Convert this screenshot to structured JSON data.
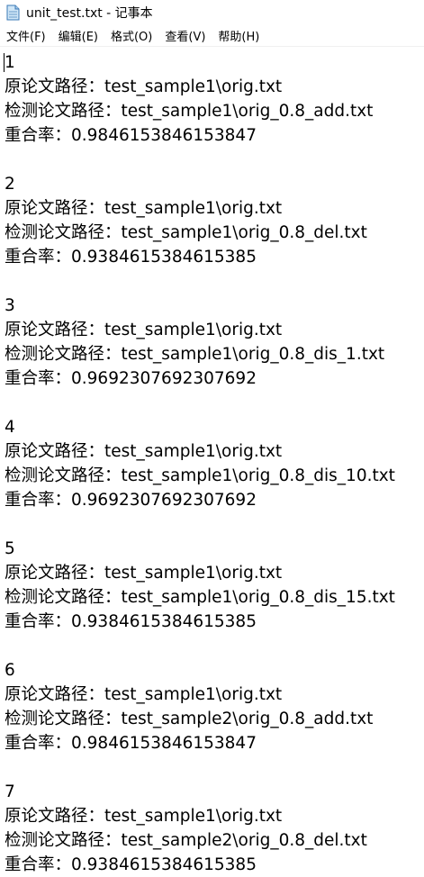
{
  "window": {
    "title": "unit_test.txt - 记事本"
  },
  "menu": [
    {
      "label": "文件(F)"
    },
    {
      "label": "编辑(E)"
    },
    {
      "label": "格式(O)"
    },
    {
      "label": "查看(V)"
    },
    {
      "label": "帮助(H)"
    }
  ],
  "document": {
    "lines": [
      "1",
      "原论文路径：test_sample1\\orig.txt",
      "检测论文路径：test_sample1\\orig_0.8_add.txt",
      "重合率：0.9846153846153847",
      "",
      "2",
      "原论文路径：test_sample1\\orig.txt",
      "检测论文路径：test_sample1\\orig_0.8_del.txt",
      "重合率：0.9384615384615385",
      "",
      "3",
      "原论文路径：test_sample1\\orig.txt",
      "检测论文路径：test_sample1\\orig_0.8_dis_1.txt",
      "重合率：0.9692307692307692",
      "",
      "4",
      "原论文路径：test_sample1\\orig.txt",
      "检测论文路径：test_sample1\\orig_0.8_dis_10.txt",
      "重合率：0.9692307692307692",
      "",
      "5",
      "原论文路径：test_sample1\\orig.txt",
      "检测论文路径：test_sample1\\orig_0.8_dis_15.txt",
      "重合率：0.9384615384615385",
      "",
      "6",
      "原论文路径：test_sample1\\orig.txt",
      "检测论文路径：test_sample2\\orig_0.8_add.txt",
      "重合率：0.9846153846153847",
      "",
      "7",
      "原论文路径：test_sample1\\orig.txt",
      "检测论文路径：test_sample2\\orig_0.8_del.txt",
      "重合率：0.9384615384615385"
    ]
  },
  "icons": {
    "app": "notepad-icon"
  }
}
